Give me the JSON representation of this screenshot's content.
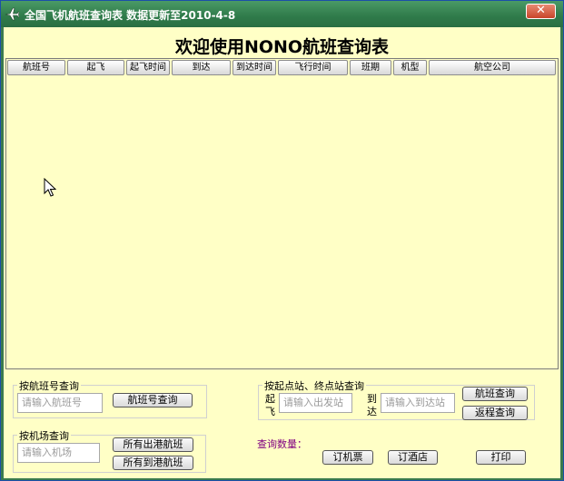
{
  "window": {
    "title": "全国飞机航班查询表  数据更新至2010-4-8",
    "close_glyph": "✕"
  },
  "heading": "欢迎使用NONO航班查询表",
  "columns": [
    "航班号",
    "起飞",
    "起飞时间",
    "到达",
    "到达时间",
    "飞行时间",
    "班期",
    "机型",
    "航空公司"
  ],
  "flight_no_group": {
    "title": "按航班号查询",
    "input_placeholder": "请输入航班号",
    "search_label": "航班号查询"
  },
  "route_group": {
    "title": "按起点站、终点站查询",
    "depart_label": "起飞",
    "arrive_label": "到达",
    "depart_placeholder": "请输入出发站",
    "arrive_placeholder": "请输入到达站",
    "flight_search_label": "航班查询",
    "return_search_label": "返程查询"
  },
  "airport_group": {
    "title": "按机场查询",
    "input_placeholder": "请输入机场",
    "all_departing_label": "所有出港航班",
    "all_arriving_label": "所有到港航班"
  },
  "footer": {
    "count_label": "查询数量：",
    "book_ticket_label": "订机票",
    "book_hotel_label": "订酒店",
    "print_label": "打印"
  },
  "colors": {
    "client_bg": "#ffffc6",
    "titlebar": "#2f7a4a",
    "count_label": "#800080"
  }
}
